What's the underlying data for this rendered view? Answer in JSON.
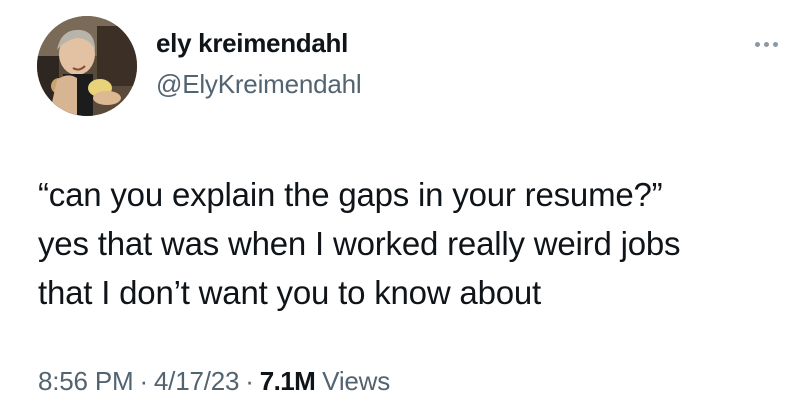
{
  "author": {
    "display_name": "ely kreimendahl",
    "handle": "@ElyKreimendahl"
  },
  "tweet": {
    "lines": [
      "“can you explain the gaps in your resume?”",
      "yes that was when I worked really weird jobs",
      "that I don’t want you to know about"
    ]
  },
  "meta": {
    "time": "8:56 PM",
    "separator": "·",
    "date": "4/17/23",
    "views_count": "7.1M",
    "views_label": "Views"
  },
  "icons": {
    "more": "more-horizontal-icon"
  },
  "colors": {
    "text_primary": "#0f1419",
    "text_secondary": "#536471",
    "background": "#ffffff"
  }
}
